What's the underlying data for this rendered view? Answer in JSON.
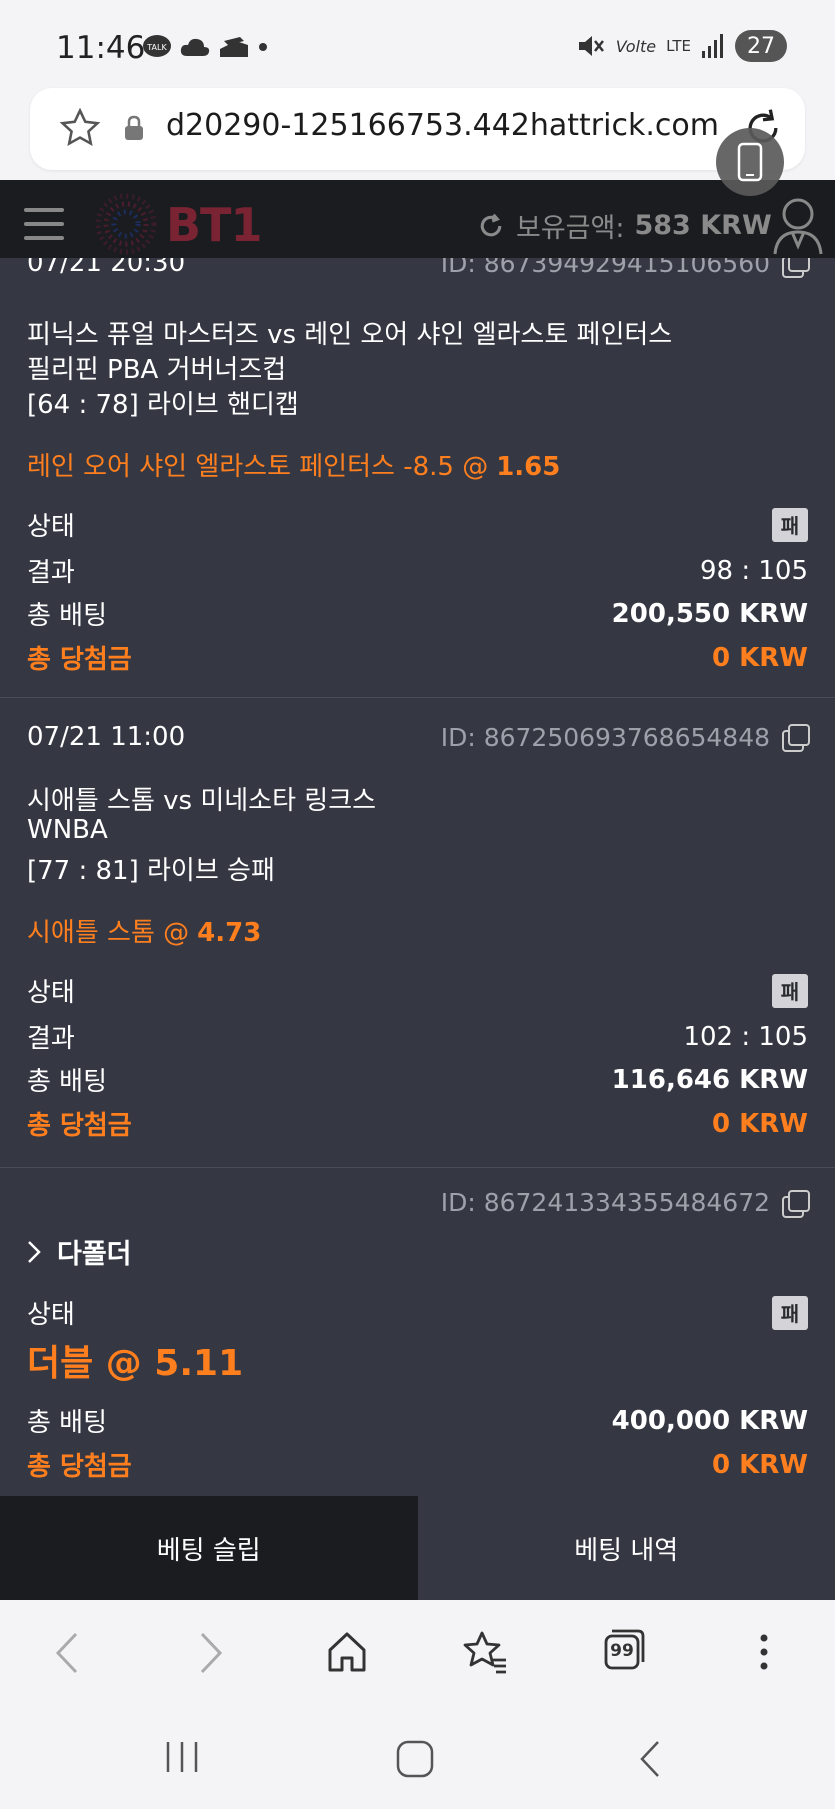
{
  "status_bar": {
    "time": "11:46",
    "battery": "27",
    "icons": [
      "talk-icon",
      "cloud-icon",
      "drive-icon",
      "dot-icon",
      "mute-icon",
      "volte-icon",
      "lte-icon",
      "signal-icon"
    ],
    "volte": "Volte",
    "lte": "LTE"
  },
  "browser": {
    "url": "d20290-125166753.442hattrick.com"
  },
  "header": {
    "logo": "BT1",
    "balance_label": "보유금액:",
    "balance_amount": "583 KRW"
  },
  "bets": [
    {
      "date": "07/21 20:30",
      "id": "ID: 867394929415106560",
      "match": "피닉스 퓨얼 마스터즈 vs 레인 오어 샤인 엘라스토 페인터스",
      "league": "필리핀 PBA 거버너즈컵",
      "market": "[64 : 78] 라이브 핸디캡",
      "pick": "레인 오어 샤인 엘라스토 페인터스 -8.5 @",
      "odds": "1.65",
      "status_label": "상태",
      "status_badge": "패",
      "result_label": "결과",
      "result_value": "98 : 105",
      "stake_label": "총 배팅",
      "stake_value": "200,550 KRW",
      "win_label": "총 당첨금",
      "win_value": "0 KRW"
    },
    {
      "date": "07/21 11:00",
      "id": "ID: 867250693768654848",
      "match": "시애틀 스톰 vs 미네소타 링크스",
      "league": "WNBA",
      "market": "[77 : 81] 라이브 승패",
      "pick": "시애틀 스톰 @",
      "odds": "4.73",
      "status_label": "상태",
      "status_badge": "패",
      "result_label": "결과",
      "result_value": "102 : 105",
      "stake_label": "총 배팅",
      "stake_value": "116,646 KRW",
      "win_label": "총 당첨금",
      "win_value": "0 KRW"
    },
    {
      "id": "ID: 867241334355484672",
      "multi_title": "다폴더",
      "status_label": "상태",
      "status_badge": "패",
      "double_odds": "더블 @ 5.11",
      "stake_label": "총 배팅",
      "stake_value": "400,000 KRW",
      "win_label": "총 당첨금",
      "win_value": "0 KRW"
    }
  ],
  "tabs": {
    "slip": "베팅 슬립",
    "history": "베팅 내역"
  },
  "browser_nav": {
    "tabs_count": "99"
  }
}
